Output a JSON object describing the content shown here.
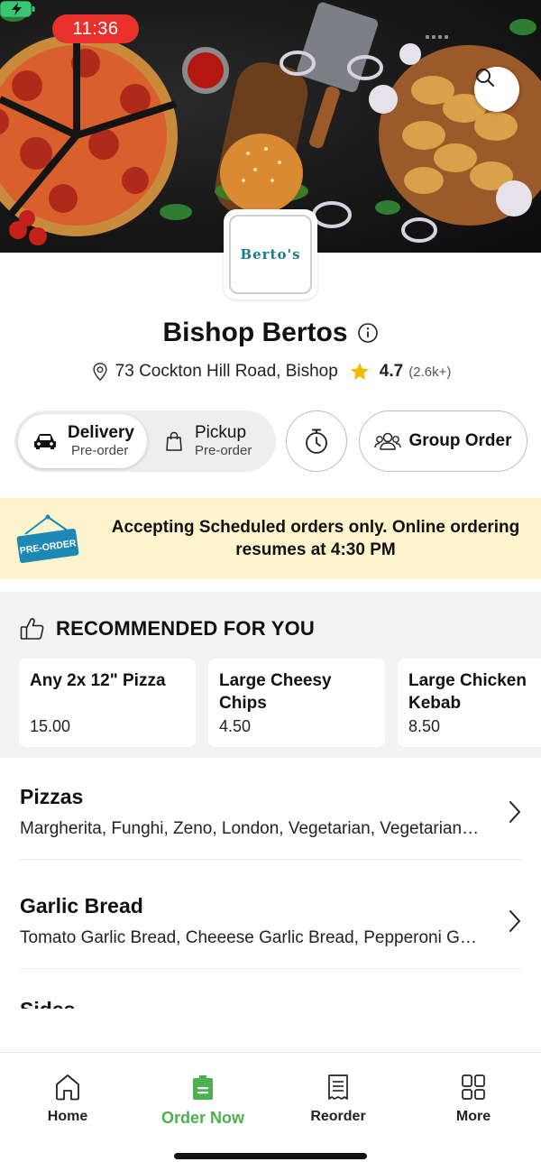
{
  "status_bar": {
    "time": "11:36"
  },
  "restaurant": {
    "logo_text": "Berto's",
    "name": "Bishop Bertos",
    "address": "73 Cockton Hill Road, Bishop",
    "rating": "4.7",
    "rating_count": "(2.6k+)"
  },
  "order_mode": {
    "delivery": {
      "label": "Delivery",
      "sub": "Pre-order",
      "selected": true
    },
    "pickup": {
      "label": "Pickup",
      "sub": "Pre-order",
      "selected": false
    },
    "group_order_label": "Group Order"
  },
  "banner": {
    "sign_text": "PRE-ORDER",
    "message": "Accepting Scheduled orders only. Online ordering resumes at 4:30 PM"
  },
  "recommended": {
    "heading": "RECOMMENDED FOR YOU",
    "items": [
      {
        "name": "Any 2x 12\" Pizza",
        "price": "15.00"
      },
      {
        "name": "Large Cheesy Chips",
        "price": "4.50"
      },
      {
        "name": "Large Chicken Kebab",
        "price": "8.50"
      }
    ]
  },
  "categories": [
    {
      "name": "Pizzas",
      "description": "Margherita, Funghi, Zeno, London, Vegetarian, Vegetarian Supreme"
    },
    {
      "name": "Garlic Bread",
      "description": "Tomato Garlic Bread, Cheeese Garlic Bread, Pepperoni Garlic Bread"
    },
    {
      "name": "Sides",
      "description": ""
    }
  ],
  "bottom_nav": [
    {
      "label": "Home",
      "icon": "home-icon",
      "active": false
    },
    {
      "label": "Order Now",
      "icon": "order-bag-icon",
      "active": true
    },
    {
      "label": "Reorder",
      "icon": "receipt-icon",
      "active": false
    },
    {
      "label": "More",
      "icon": "grid-icon",
      "active": false
    }
  ],
  "colors": {
    "accent_green": "#4caf50",
    "time_pill_red": "#e8312b",
    "banner_bg": "#fdf4cd",
    "star_gold": "#f5b800",
    "logo_teal": "#1b7a8c"
  }
}
